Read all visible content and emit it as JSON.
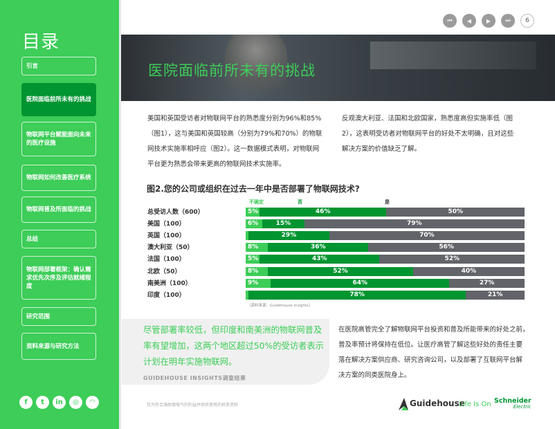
{
  "sidebar": {
    "title": "目录",
    "items": [
      {
        "label": "引言",
        "active": false
      },
      {
        "label": "医院面临前所未有的挑战",
        "active": true
      },
      {
        "label": "物联网平台赋能面向未来的医疗设施",
        "active": false
      },
      {
        "label": "物联网如何改善医疗系统",
        "active": false
      },
      {
        "label": "物联网普及所面临的挑战",
        "active": false
      },
      {
        "label": "总结",
        "active": false
      },
      {
        "label": "物联网部署框架：确认需求优先次序及评估就绪程度",
        "active": false
      },
      {
        "label": "研究范围",
        "active": false
      },
      {
        "label": "资料来源与研究方法",
        "active": false
      }
    ],
    "social": [
      {
        "icon": "facebook-icon",
        "glyph": "f"
      },
      {
        "icon": "twitter-icon",
        "glyph": "t"
      },
      {
        "icon": "linkedin-icon",
        "glyph": "in"
      },
      {
        "icon": "instagram-icon",
        "glyph": "◎"
      },
      {
        "icon": "rss-icon",
        "glyph": "◠"
      }
    ]
  },
  "nav": {
    "first": "⏮",
    "prev": "◀",
    "next": "▶",
    "last": "⏭",
    "page": "6"
  },
  "banner": {
    "title": "医院面临前所未有的挑战"
  },
  "body": {
    "left_lines": [
      "美国和英国受访者对物联网平台的熟悉度分别为96%和85%",
      "（图1），这与美国和英国较高（分别为79%和70%）的物联",
      "网技术实施率相呼应（图2）。这一数据模式表明，对物联网",
      "平台更为熟悉会带来更高的物联网技术实施率。"
    ],
    "right_lines": [
      "反观澳大利亚、法国和北欧国家，熟悉度高但实施率低（图",
      "2），这表明受访者对物联网平台的好处不太明确，且对这些",
      "解决方案的价值缺乏了解。"
    ],
    "bottom_lines": [
      "在医院高管完全了解物联网平台投资和普及所能带来的好处之前，",
      "普及率预计将保持在低位。让医疗高管了解这些好处的责任主要",
      "落在解决方案供应商、研究咨询公司，以及部署了互联网平台解",
      "决方案的同类医院身上。"
    ]
  },
  "chart_data": {
    "type": "bar",
    "stacked": true,
    "orientation": "horizontal",
    "title": "图2.您的公司或组织在过去一年中是否部署了物联网技术?",
    "categories": [
      "总受访人数（600）",
      "美国（100）",
      "英国（100）",
      "澳大利亚（50）",
      "法国（100）",
      "北欧（50）",
      "南美洲（100）",
      "印度（100）"
    ],
    "series": [
      {
        "name": "不确定",
        "color": "#3dcd58",
        "values": [
          5,
          6,
          1,
          8,
          5,
          8,
          9,
          1
        ]
      },
      {
        "name": "否",
        "color": "#009530",
        "values": [
          46,
          15,
          29,
          36,
          43,
          52,
          64,
          78
        ]
      },
      {
        "name": "是",
        "color": "#626469",
        "values": [
          50,
          79,
          70,
          56,
          52,
          40,
          27,
          21
        ]
      }
    ],
    "labels": [
      [
        "5%",
        "46%",
        "50%"
      ],
      [
        "6%",
        "15%",
        "79%"
      ],
      [
        "1%",
        "29%",
        "70%"
      ],
      [
        "8%",
        "36%",
        "56%"
      ],
      [
        "5%",
        "43%",
        "52%"
      ],
      [
        "8%",
        "52%",
        "40%"
      ],
      [
        "9%",
        "64%",
        "27%"
      ],
      [
        "1%",
        "78%",
        "21%"
      ]
    ],
    "source": "（资料来源：Guidehouse Insights）"
  },
  "callout": {
    "quote": "尽管部署率较低，但印度和南美洲的物联网普及率有望增加，这两个地区超过50%的受访者表示计划在明年实施物联网。",
    "source": "GUIDEHOUSE INSIGHTS调查结果"
  },
  "footer": {
    "note": "仅为符合施耐德电气的利益并供其使用的机密资料",
    "brand1": "Guidehouse",
    "brand2": "Life Is On",
    "brand3": "Schneider",
    "brand3_sub": "Electric"
  }
}
